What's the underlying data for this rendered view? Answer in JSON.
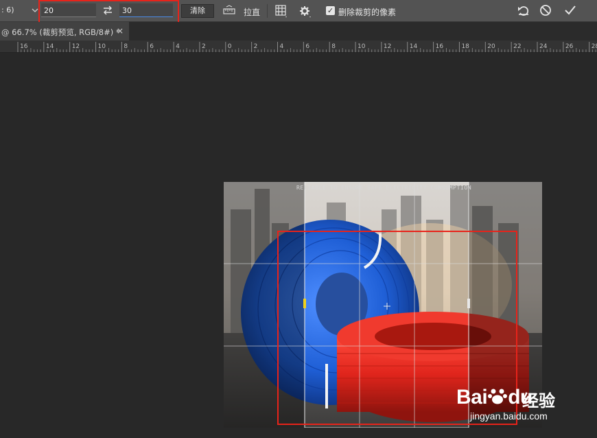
{
  "options_bar": {
    "ratio_value": ": 6)",
    "width_value": "20",
    "height_value": "30",
    "clear_label": "清除",
    "straighten_label": "拉直",
    "delete_cropped_label": "删除裁剪的像素",
    "delete_cropped_checked": true
  },
  "document_tab": {
    "title": "@ 66.7% (裁剪预览, RGB/8#) *",
    "close": "×"
  },
  "ruler": {
    "labels": [
      "16",
      "14",
      "12",
      "10",
      "8",
      "6",
      "4",
      "2",
      "0",
      "2",
      "4",
      "6",
      "8",
      "10",
      "12",
      "14",
      "16",
      "18",
      "20",
      "22",
      "24",
      "26",
      "28"
    ]
  },
  "canvas": {
    "banner_text": "RELIABLE TO ENSURE SAFE ELECTRICITY CONSUMPTION"
  },
  "watermark": {
    "brand": "Bai",
    "brand_suffix": "du",
    "product": "经验",
    "url": "jingyan.baidu.com"
  },
  "colors": {
    "highlight": "#e8231a",
    "toolbar_bg": "#535353",
    "canvas_bg": "#282828",
    "cable_blue": "#1f5fd6",
    "cable_red": "#e0251c"
  }
}
